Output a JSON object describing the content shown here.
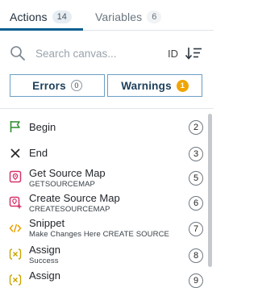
{
  "tabs": [
    {
      "label": "Actions",
      "count": "14"
    },
    {
      "label": "Variables",
      "count": "6"
    }
  ],
  "search": {
    "placeholder": "Search canvas..."
  },
  "sort": {
    "id_label": "ID"
  },
  "filters": {
    "errors": {
      "label": "Errors",
      "count": "0"
    },
    "warnings": {
      "label": "Warnings",
      "count": "1"
    }
  },
  "colors": {
    "accent": "#0b5f8f",
    "flag_green": "#2e8b2e",
    "source_map_pink": "#d6336c",
    "snippet_orange": "#e8a000",
    "assign_yellow": "#c9a400",
    "warning": "#f0a500"
  },
  "items": [
    {
      "title": "Begin",
      "subtitle": "",
      "number": "2",
      "icon": "flag-icon"
    },
    {
      "title": "End",
      "subtitle": "",
      "number": "3",
      "icon": "close-icon"
    },
    {
      "title": "Get Source Map",
      "subtitle": "GETSOURCEMAP",
      "number": "5",
      "icon": "source-map-icon"
    },
    {
      "title": "Create Source Map",
      "subtitle": "CREATESOURCEMAP",
      "number": "6",
      "icon": "create-source-map-icon"
    },
    {
      "title": "Snippet",
      "subtitle": "Make Changes Here CREATE SOURCE",
      "number": "7",
      "icon": "code-icon"
    },
    {
      "title": "Assign",
      "subtitle": "Success",
      "number": "8",
      "icon": "variable-icon"
    },
    {
      "title": "Assign",
      "subtitle": "",
      "number": "9",
      "icon": "variable-icon"
    }
  ]
}
